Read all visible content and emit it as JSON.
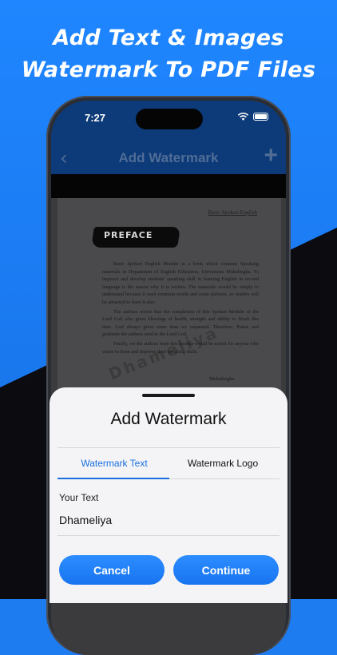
{
  "headline": [
    "Add Text & Images",
    "Watermark To PDF Files"
  ],
  "status_bar": {
    "time": "7:27",
    "icons": [
      "wifi-icon",
      "battery-icon"
    ]
  },
  "nav": {
    "back_icon": "chevron-left-icon",
    "title": "Add Watermark",
    "add_icon": "plus-icon"
  },
  "document": {
    "header": "Basic Spoken English",
    "heading": "PREFACE",
    "paragraphs": [
      "Basic Spoken English Module is a book which contains Speaking materials in Department of English Education, Universitas Muhalingka. To improve and develop students' speaking skill in learning English in second language is the reason why it is written. The materials would be simply to understand because it used common words and some pictures, so readers will be attracted to learn it also.",
      "The authors notice that the completion of this Spoken Module of the Lord God who gives blessings of health, strength and ability to finish this time. God always gives more than we requested. Therefore, Praise and gratitude the authors send to the Lord God.",
      "Finally, we the authors hope this module would be useful for anyone who wants to learn and improve their speaking skills."
    ],
    "signature": "Muhalingka",
    "watermark": "Dhameliya"
  },
  "sheet": {
    "title": "Add Watermark",
    "tabs": [
      {
        "label": "Watermark Text",
        "active": true
      },
      {
        "label": "Watermark Logo",
        "active": false
      }
    ],
    "field_label": "Your Text",
    "field_value": "Dhameliya",
    "cancel_label": "Cancel",
    "continue_label": "Continue"
  },
  "colors": {
    "accent": "#1a6fe0",
    "nav_bg": "#0d3a78",
    "dark_bg": "#0c0c10"
  }
}
